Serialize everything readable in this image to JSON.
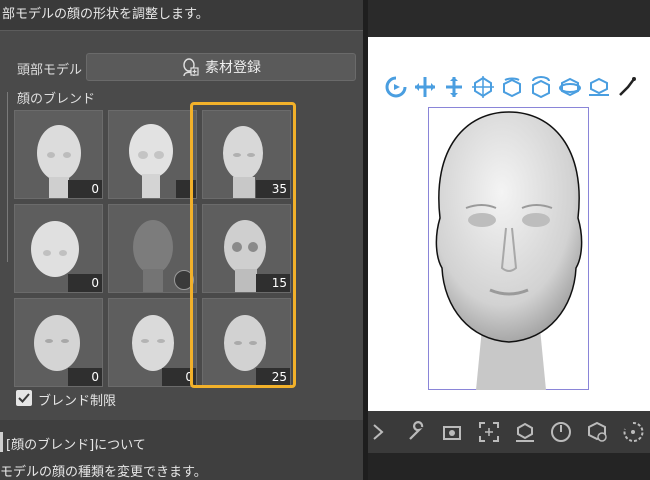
{
  "panel": {
    "description": "部モデルの顔の形状を調整します。",
    "head_model_label": "頭部モデル",
    "register_button_label": "素材登録",
    "face_blend_label": "顔のブレンド",
    "blend_limit_label": "ブレンド制限",
    "blend_limit_checked": true,
    "about_link": "[顔のブレンド]について",
    "change_description": "モデルの顔の種類を変更できます。"
  },
  "blend_grid": [
    {
      "name": "face-1",
      "value": "0"
    },
    {
      "name": "face-2",
      "value": ""
    },
    {
      "name": "face-3",
      "value": "35"
    },
    {
      "name": "face-4",
      "value": "0"
    },
    {
      "name": "face-5",
      "value": ""
    },
    {
      "name": "face-6",
      "value": "15"
    },
    {
      "name": "face-7",
      "value": "0"
    },
    {
      "name": "face-8",
      "value": "0"
    },
    {
      "name": "face-9",
      "value": "25"
    }
  ],
  "colors": {
    "highlight": "#f2b12a",
    "toolbar_icon": "#4a9ee0",
    "selection": "#8a85d8"
  },
  "canvas_toolbar_icons": [
    "rotate-camera-icon",
    "pan-horizontal-icon",
    "pan-vertical-icon",
    "move-model-icon",
    "rotate-model-icon",
    "rotate-y-icon",
    "rotate-z-icon",
    "ground-icon",
    "pose-icon"
  ],
  "bottom_tools_icons": [
    "chevron-right-icon",
    "wrench-icon",
    "camera-icon",
    "fit-view-icon",
    "ground-snap-icon",
    "timer-icon",
    "model-settings-icon",
    "reset-icon"
  ]
}
